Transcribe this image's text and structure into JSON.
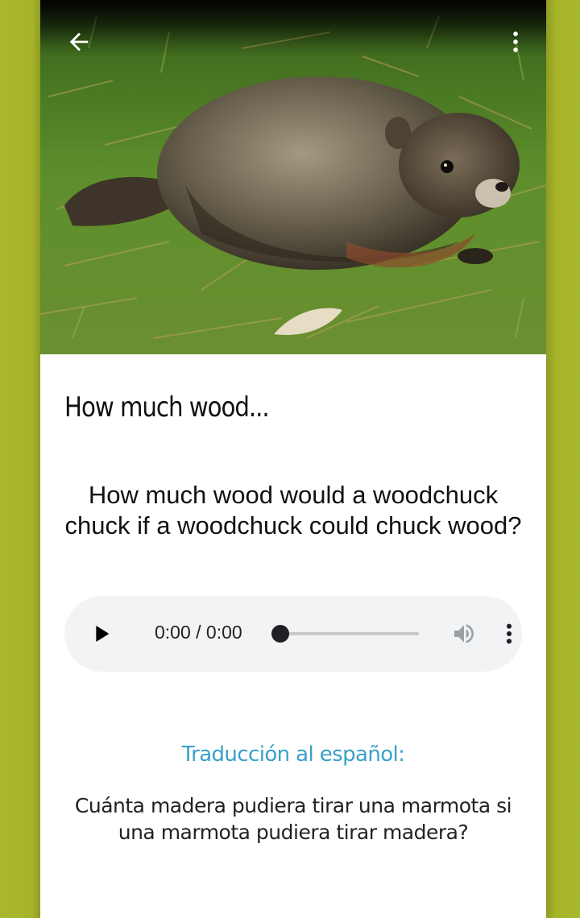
{
  "screen": {
    "title": "How much wood...",
    "phrase": "How much wood would a woodchuck chuck if a woodchuck could chuck wood?",
    "translation_label": "Traducción al español:",
    "translation": "Cuánta madera pudiera tirar una marmota si una marmota pudiera tirar madera?"
  },
  "hero": {
    "image_subject": "woodchuck on grass",
    "back_icon": "arrow-back-icon",
    "menu_icon": "more-vert-icon"
  },
  "audio_player": {
    "time": "0:00 / 0:00",
    "progress": 0,
    "icons": [
      "play-icon",
      "volume-icon",
      "more-vert-icon"
    ]
  },
  "colors": {
    "frame": "#a6b42a",
    "accent": "#3ba0c9",
    "player_bg": "#f1f3f4"
  }
}
